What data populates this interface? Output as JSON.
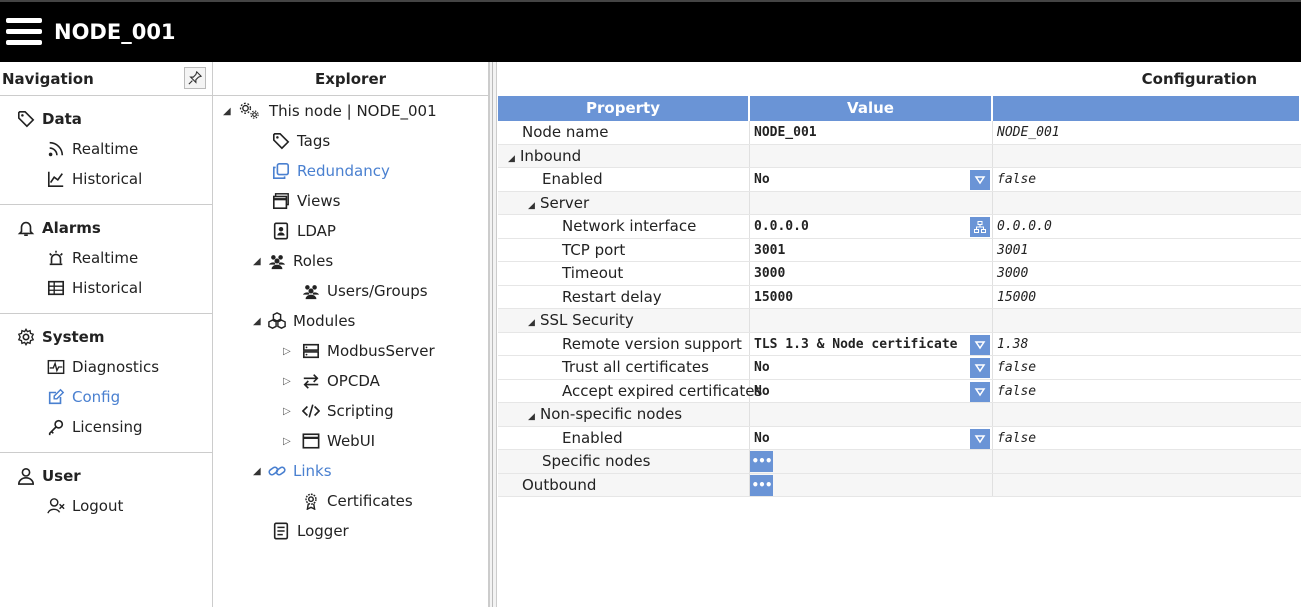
{
  "app": {
    "title": "NODE_001"
  },
  "navigation": {
    "title": "Navigation",
    "sections": [
      {
        "label": "Data",
        "icon": "tag-icon",
        "items": [
          {
            "label": "Realtime",
            "icon": "rss-icon"
          },
          {
            "label": "Historical",
            "icon": "line-chart-icon"
          }
        ]
      },
      {
        "label": "Alarms",
        "icon": "bell-icon",
        "items": [
          {
            "label": "Realtime",
            "icon": "siren-icon"
          },
          {
            "label": "Historical",
            "icon": "table-icon"
          }
        ]
      },
      {
        "label": "System",
        "icon": "gear-icon",
        "items": [
          {
            "label": "Diagnostics",
            "icon": "pulse-icon"
          },
          {
            "label": "Config",
            "icon": "edit-icon",
            "active": true
          },
          {
            "label": "Licensing",
            "icon": "key-icon"
          }
        ]
      },
      {
        "label": "User",
        "icon": "user-icon",
        "items": [
          {
            "label": "Logout",
            "icon": "user-x-icon"
          }
        ]
      }
    ]
  },
  "explorer": {
    "title": "Explorer",
    "items": [
      {
        "label": "This node | NODE_001",
        "icon": "gears-icon"
      },
      {
        "label": "Tags",
        "icon": "tag-icon"
      },
      {
        "label": "Redundancy",
        "icon": "copy-icon",
        "active": true
      },
      {
        "label": "Views",
        "icon": "window-icon"
      },
      {
        "label": "LDAP",
        "icon": "contact-icon"
      },
      {
        "label": "Roles",
        "icon": "users-icon"
      },
      {
        "label": "Users/Groups",
        "icon": "users-icon"
      },
      {
        "label": "Modules",
        "icon": "boxes-icon"
      },
      {
        "label": "ModbusServer",
        "icon": "server-icon"
      },
      {
        "label": "OPCDA",
        "icon": "swap-icon"
      },
      {
        "label": "Scripting",
        "icon": "code-icon"
      },
      {
        "label": "WebUI",
        "icon": "browser-icon"
      },
      {
        "label": "Links",
        "icon": "link-icon",
        "active": true
      },
      {
        "label": "Certificates",
        "icon": "certificate-icon"
      },
      {
        "label": "Logger",
        "icon": "log-icon"
      }
    ]
  },
  "config": {
    "title": "Configuration",
    "columns": [
      "Property",
      "Value",
      ""
    ],
    "rows": [
      {
        "property": "Node name",
        "value": "NODE_001",
        "default": "NODE_001"
      },
      {
        "property": "Inbound",
        "value": "",
        "default": ""
      },
      {
        "property": "Enabled",
        "value": "No",
        "default": "false"
      },
      {
        "property": "Server",
        "value": "",
        "default": ""
      },
      {
        "property": "Network interface",
        "value": "0.0.0.0",
        "default": "0.0.0.0"
      },
      {
        "property": "TCP port",
        "value": "3001",
        "default": "3001"
      },
      {
        "property": "Timeout",
        "value": "3000",
        "default": "3000"
      },
      {
        "property": "Restart delay",
        "value": "15000",
        "default": "15000"
      },
      {
        "property": "SSL Security",
        "value": "",
        "default": ""
      },
      {
        "property": "Remote version support",
        "value": "TLS 1.3 & Node certificate",
        "default": "1.38"
      },
      {
        "property": "Trust all certificates",
        "value": "No",
        "default": "false"
      },
      {
        "property": "Accept expired certificates",
        "value": "No",
        "default": "false"
      },
      {
        "property": "Non-specific nodes",
        "value": "",
        "default": ""
      },
      {
        "property": "Enabled",
        "value": "No",
        "default": "false"
      },
      {
        "property": "Specific nodes",
        "value": "",
        "default": ""
      },
      {
        "property": "Outbound",
        "value": "",
        "default": ""
      }
    ],
    "ellipsis": "•••"
  },
  "colors": {
    "accent": "#6a94d6",
    "active_link": "#4a80d0",
    "topbar": "#000000"
  }
}
